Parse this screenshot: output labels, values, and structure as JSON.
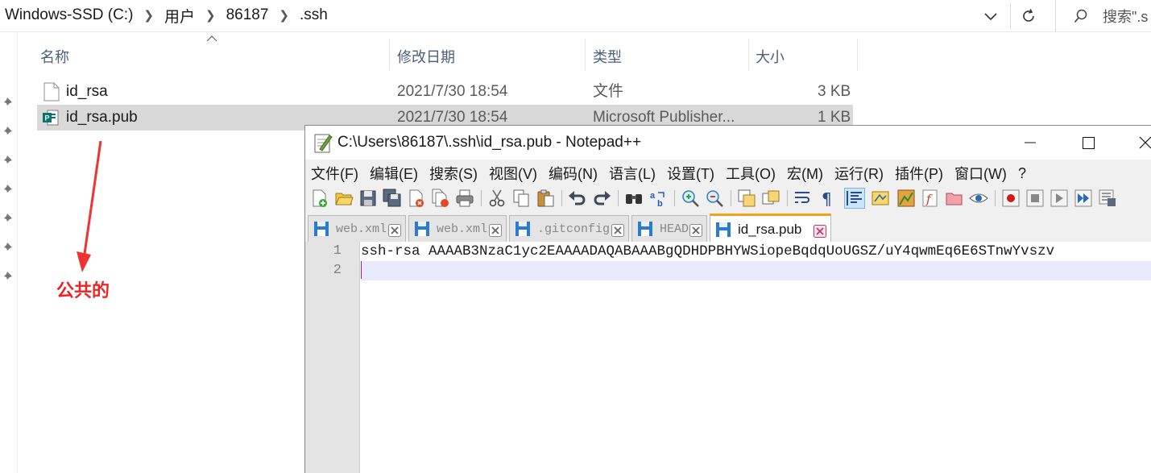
{
  "explorer": {
    "breadcrumb": [
      "Windows-SSD (C:)",
      "用户",
      "86187",
      ".ssh"
    ],
    "search_placeholder": "搜索\".s",
    "columns": {
      "name": "名称",
      "modified": "修改日期",
      "type": "类型",
      "size": "大小"
    },
    "files": [
      {
        "name": "id_rsa",
        "modified": "2021/7/30 18:54",
        "type": "文件",
        "size": "3 KB",
        "icon": "file-icon"
      },
      {
        "name": "id_rsa.pub",
        "modified": "2021/7/30 18:54",
        "type": "Microsoft Publisher...",
        "size": "1 KB",
        "icon": "publisher-file-icon",
        "selected": true
      }
    ],
    "annotation": "公共的",
    "annotation_color": "#ee2222"
  },
  "notepad": {
    "title": "C:\\Users\\86187\\.ssh\\id_rsa.pub - Notepad++",
    "menu": [
      "文件(F)",
      "编辑(E)",
      "搜索(S)",
      "视图(V)",
      "编码(N)",
      "语言(L)",
      "设置(T)",
      "工具(O)",
      "宏(M)",
      "运行(R)",
      "插件(P)",
      "窗口(W)",
      "?"
    ],
    "tabs": [
      "web.xml",
      "web.xml",
      ".gitconfig",
      "HEAD",
      "id_rsa.pub"
    ],
    "active_tab_index": 4,
    "line_numbers": [
      "1",
      "2"
    ],
    "lines": [
      "ssh-rsa AAAAB3NzaC1yc2EAAAADAQABAAABgQDHDPBHYWSiopeBqdqUoUGSZ/uY4qwmEq6E6STnwYvszv",
      ""
    ],
    "accent_color": "#f6a11a",
    "current_line_color": "#e8e8ff"
  }
}
